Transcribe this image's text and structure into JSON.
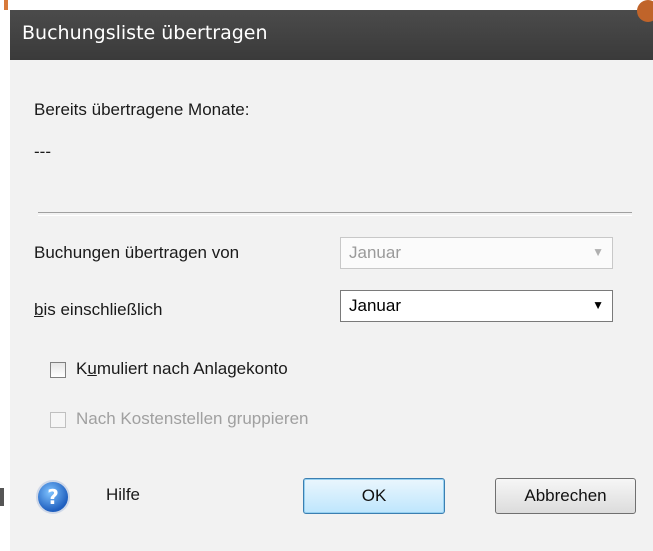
{
  "window": {
    "title": "Buchungsliste übertragen"
  },
  "info": {
    "months_label": "Bereits übertragene Monate:",
    "months_value": "---"
  },
  "range": {
    "from_label": "Buchungen übertragen von",
    "from_value": "Januar",
    "to_label_mnemonic": "b",
    "to_label_rest": "is einschließlich",
    "to_value": "Januar"
  },
  "options": {
    "cumulative_mnemonic_pre": "K",
    "cumulative_mnemonic": "u",
    "cumulative_rest": "muliert nach Anlagekonto",
    "cumulative_checked": false,
    "cost_center_pre": "Nach Kostenstellen ",
    "cost_center_mnemonic": "g",
    "cost_center_rest": "ruppieren",
    "cost_center_checked": false,
    "cost_center_enabled": false
  },
  "footer": {
    "help_label": "Hilfe",
    "ok_label": "OK",
    "cancel_label": "Abbrechen"
  },
  "icons": {
    "help": "help-question-icon",
    "dropdown": "chevron-down-icon"
  }
}
